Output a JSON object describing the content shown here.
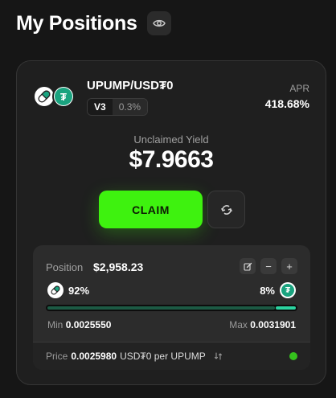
{
  "header": {
    "title": "My Positions",
    "visibility_icon": "eye-icon"
  },
  "position": {
    "pair": "UPUMP/USD₮0",
    "version": "V3",
    "fee": "0.3%",
    "apr_label": "APR",
    "apr_value": "418.68%",
    "token0_icon": "pill-icon",
    "token1_icon": "tether-icon",
    "token1_symbol": "₮",
    "yield_label": "Unclaimed Yield",
    "yield_value": "$7.9663",
    "claim_label": "CLAIM",
    "refresh_icon": "swap-refresh-icon",
    "details": {
      "position_label": "Position",
      "position_value": "$2,958.23",
      "actions": [
        "edit-icon",
        "minus-icon",
        "plus-icon"
      ],
      "minus_symbol": "−",
      "plus_symbol": "+",
      "token0_share": "92%",
      "token1_share": "8%",
      "range_token0_fraction": 0.92,
      "range_token1_fraction": 0.08,
      "min_label": "Min",
      "min_value": "0.0025550",
      "max_label": "Max",
      "max_value": "0.0031901",
      "price_label": "Price",
      "price_value": "0.0025980",
      "price_unit": "USD₮0 per UPUMP",
      "price_switch_icon": "switch-arrows-icon",
      "in_range_color": "#35c21d"
    }
  },
  "colors": {
    "accent_green": "#3ef20f",
    "tether_green": "#1aa37f",
    "range_dark": "#1c5a44",
    "range_light": "#2bd3a0"
  }
}
